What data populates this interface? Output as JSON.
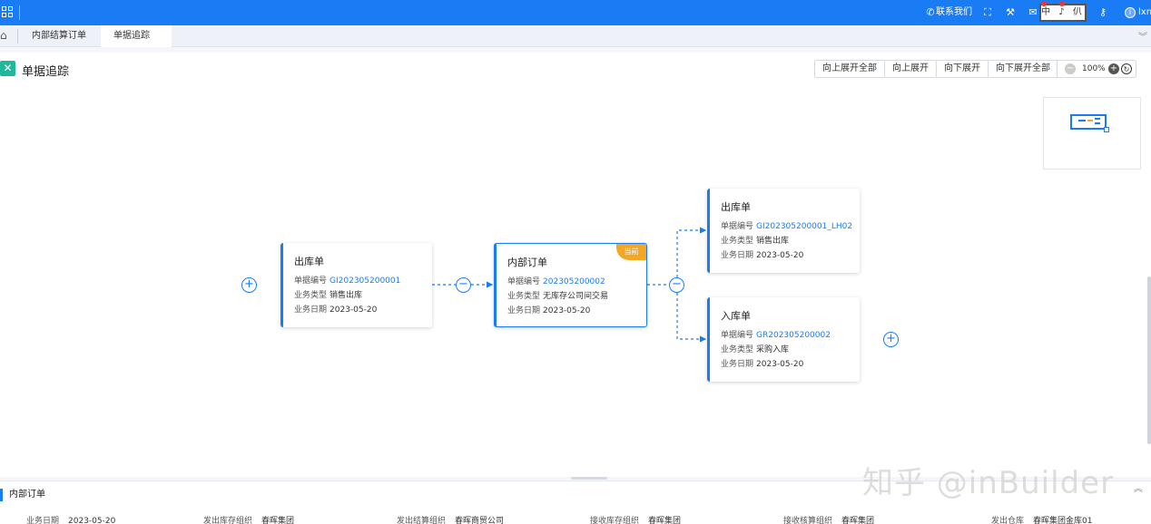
{
  "topbar": {
    "contact_label": "联系我们",
    "ime_text": "中 ♪ 仈",
    "user_name": "lxn",
    "user_initial": "i"
  },
  "tabs": [
    {
      "label": "内部结算订单",
      "active": false
    },
    {
      "label": "单据追踪",
      "active": true
    }
  ],
  "page": {
    "title": "单据追踪",
    "buttons": [
      "向上展开全部",
      "向上展开",
      "向下展开",
      "向下展开全部"
    ],
    "zoom": "100%"
  },
  "nodes": {
    "left": {
      "title": "出库单",
      "doc_no_label": "单据编号",
      "doc_no": "GI202305200001",
      "type_label": "业务类型",
      "type": "销售出库",
      "date_label": "业务日期",
      "date": "2023-05-20"
    },
    "center": {
      "title": "内部订单",
      "badge": "当前",
      "doc_no_label": "单据编号",
      "doc_no": "202305200002",
      "type_label": "业务类型",
      "type": "无库存公司间交易",
      "date_label": "业务日期",
      "date": "2023-05-20"
    },
    "right_top": {
      "title": "出库单",
      "doc_no_label": "单据编号",
      "doc_no": "GI202305200001_LH02",
      "type_label": "业务类型",
      "type": "销售出库",
      "date_label": "业务日期",
      "date": "2023-05-20"
    },
    "right_bottom": {
      "title": "入库单",
      "doc_no_label": "单据编号",
      "doc_no": "GR202305200002",
      "type_label": "业务类型",
      "type": "采购入库",
      "date_label": "业务日期",
      "date": "2023-05-20"
    }
  },
  "bottom_panel": {
    "title": "内部订单",
    "fields": [
      {
        "label": "业务日期",
        "value": "2023-05-20"
      },
      {
        "label": "发出库存组织",
        "value": "春晖集团"
      },
      {
        "label": "发出结算组织",
        "value": "春晖商贸公司"
      },
      {
        "label": "接收库存组织",
        "value": "春晖集团"
      },
      {
        "label": "接收核算组织",
        "value": "春晖集团"
      },
      {
        "label": "发出仓库",
        "value": "春晖集团金库01"
      }
    ]
  },
  "watermark": "知乎 @inBuilder",
  "colors": {
    "primary": "#1a7cf5",
    "badge": "#f5a623",
    "title_icon": "#1fb89a"
  }
}
